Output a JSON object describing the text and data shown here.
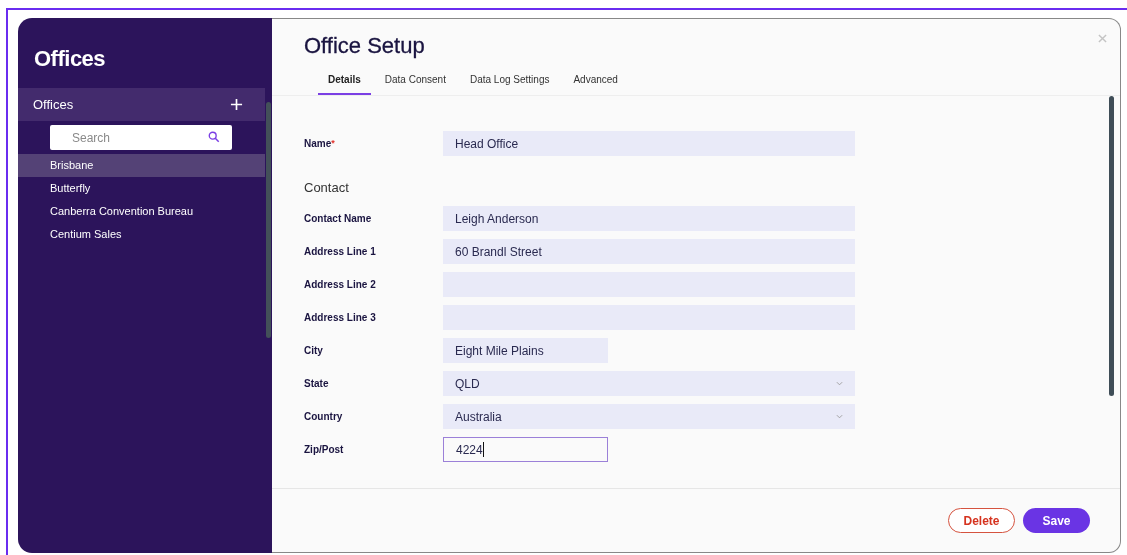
{
  "sidebar": {
    "title": "Offices",
    "header": "Offices",
    "search": {
      "placeholder": "Search"
    },
    "items": [
      {
        "label": "Brisbane",
        "selected": true
      },
      {
        "label": "Butterfly",
        "selected": false
      },
      {
        "label": "Canberra Convention Bureau",
        "selected": false
      },
      {
        "label": "Centium Sales",
        "selected": false
      }
    ]
  },
  "dialog": {
    "title": "Office Setup",
    "tabs": [
      {
        "label": "Details",
        "selected": true
      },
      {
        "label": "Data Consent",
        "selected": false
      },
      {
        "label": "Data Log Settings",
        "selected": false
      },
      {
        "label": "Advanced",
        "selected": false
      }
    ],
    "name_field": {
      "label": "Name",
      "required_mark": "*",
      "value": "Head Office"
    },
    "contact": {
      "heading": "Contact",
      "fields": [
        {
          "label": "Contact Name",
          "kind": "text",
          "value": "Leigh Anderson",
          "focused": false
        },
        {
          "label": "Address Line 1",
          "kind": "text",
          "value": "60 Brandl Street",
          "focused": false
        },
        {
          "label": "Address Line 2",
          "kind": "text",
          "focused": false
        },
        {
          "label": "Address Line 3",
          "kind": "text",
          "focused": false
        },
        {
          "label": "City",
          "kind": "short",
          "value": "Eight Mile Plains",
          "focused": false
        },
        {
          "label": "State",
          "kind": "select",
          "value": "QLD",
          "focused": false
        },
        {
          "label": "Country",
          "kind": "select",
          "value": "Australia",
          "focused": false
        },
        {
          "label": "Zip/Post",
          "kind": "short",
          "value": "4224",
          "focused": true
        }
      ]
    },
    "buttons": [
      {
        "label": "Delete",
        "kind": "danger"
      },
      {
        "label": "Save",
        "kind": "primary"
      }
    ]
  }
}
